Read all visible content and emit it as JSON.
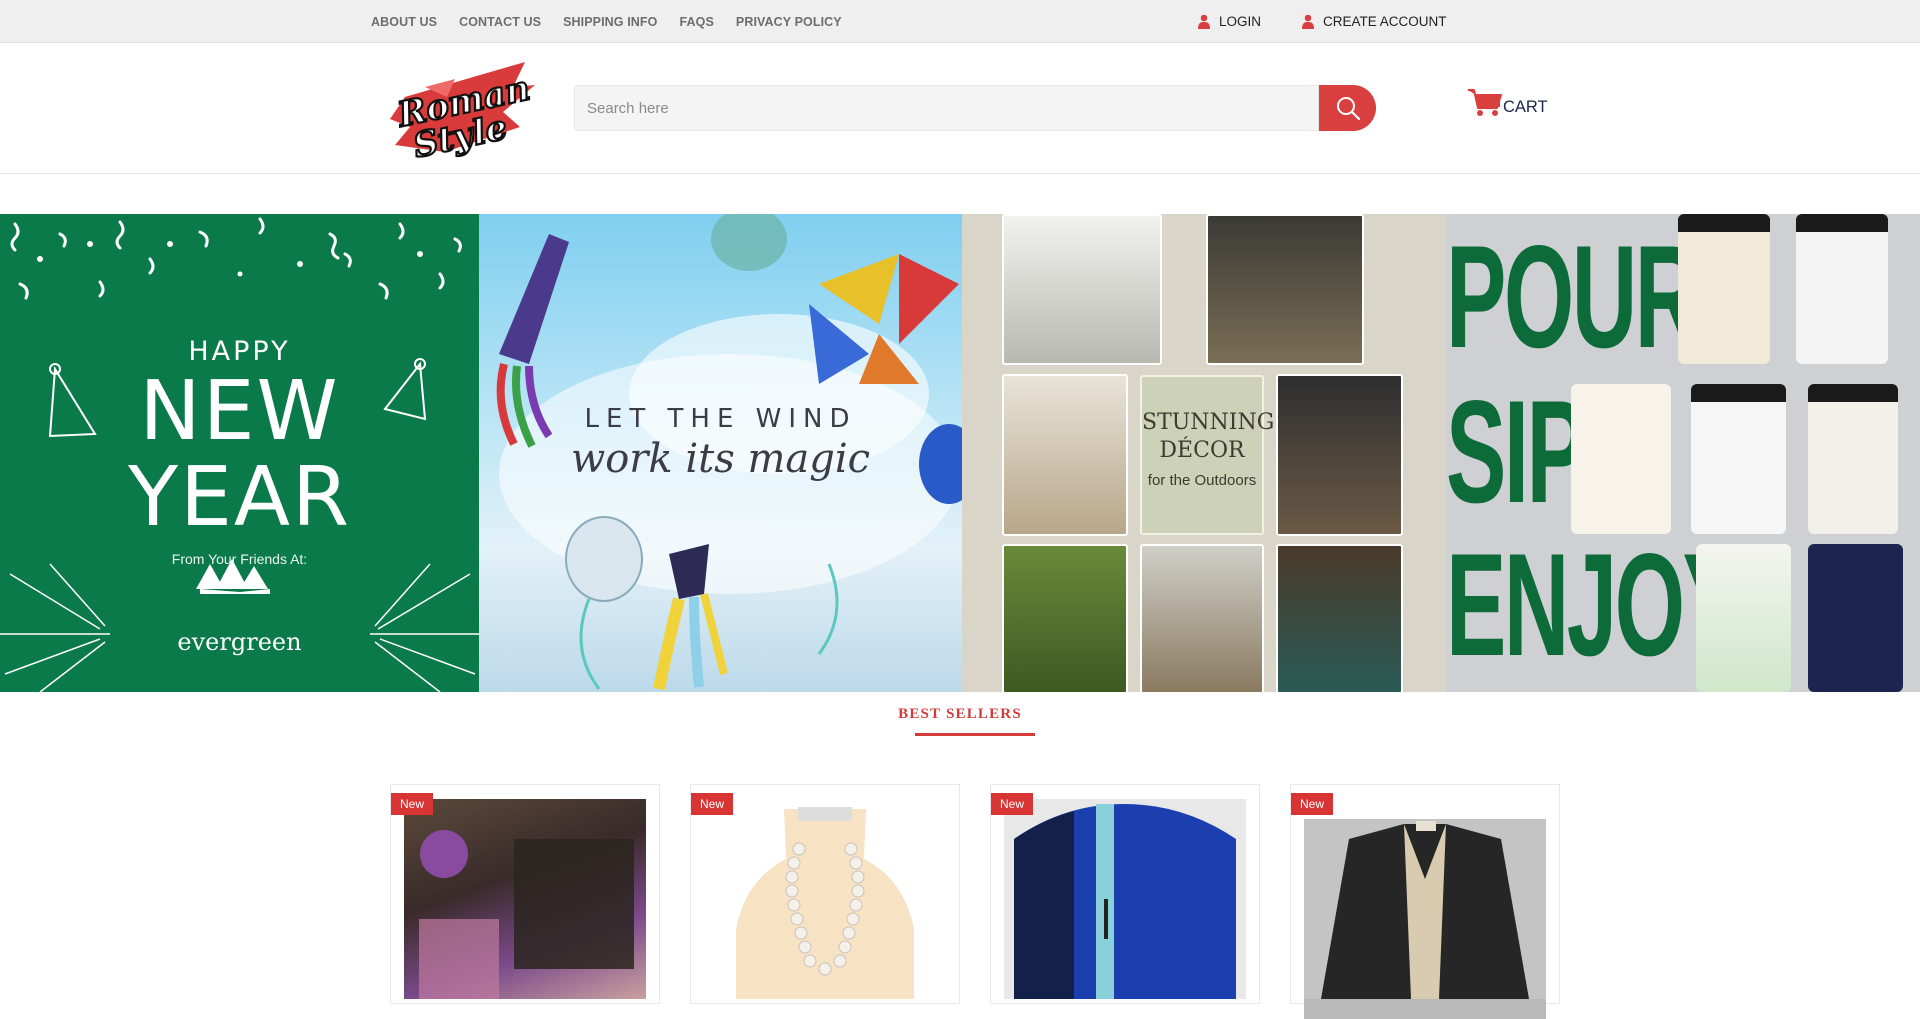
{
  "topbar": {
    "links": [
      "ABOUT US",
      "CONTACT US",
      "SHIPPING INFO",
      "FAQS",
      "PRIVACY POLICY"
    ],
    "login_label": "LOGIN",
    "create_account_label": "CREATE ACCOUNT"
  },
  "header": {
    "logo_alt": "Roman Style",
    "search_placeholder": "Search here",
    "search_icon": "search-icon",
    "cart_label": "CART",
    "cart_icon": "cart-icon",
    "accent_color": "#d93f3f"
  },
  "banner": {
    "panels": [
      {
        "happy": "HAPPY",
        "new": "NEW",
        "year": "YEAR",
        "from": "From Your Friends At:",
        "brand": "evergreen",
        "color": "#0a7a4a"
      },
      {
        "line1": "LET THE WIND",
        "line2": "work its magic"
      },
      {
        "line1": "STUNNING DÉCOR",
        "line2": "for the Outdoors"
      },
      {
        "word1": "POUR",
        "word2": "SIP",
        "word3": "ENJOY"
      }
    ]
  },
  "best_sellers": {
    "title": "BEST SELLERS",
    "products": [
      {
        "badge": "New"
      },
      {
        "badge": "New"
      },
      {
        "badge": "New"
      },
      {
        "badge": "New"
      }
    ]
  }
}
